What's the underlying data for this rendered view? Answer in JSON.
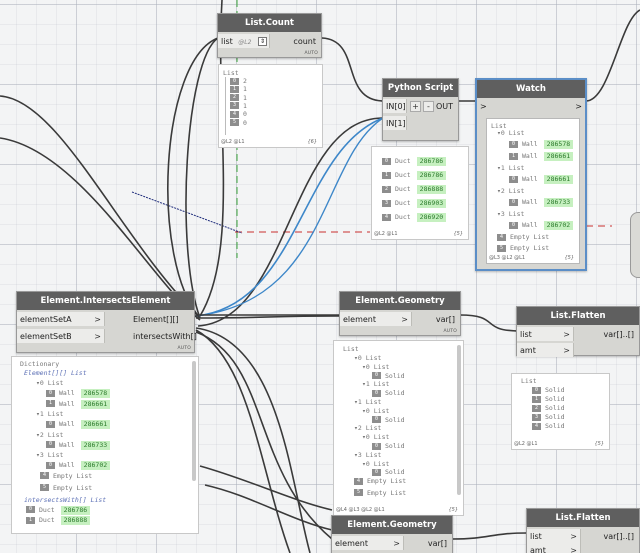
{
  "nodes": {
    "list_count": {
      "title": "List.Count",
      "input_label": "list",
      "input_hint": "@L2",
      "output_label": "count",
      "auto": "AUTO",
      "preview": {
        "header": "List",
        "items": [
          {
            "i": "0",
            "v": "2"
          },
          {
            "i": "1",
            "v": "1"
          },
          {
            "i": "2",
            "v": "1"
          },
          {
            "i": "3",
            "v": "1"
          },
          {
            "i": "4",
            "v": "0"
          },
          {
            "i": "5",
            "v": "0"
          }
        ],
        "levels": "@L2 @L1",
        "count": "{6}"
      }
    },
    "python_script": {
      "title": "Python Script",
      "inputs": [
        "IN[0]",
        "IN[1]"
      ],
      "plus": "+",
      "minus": "-",
      "output_label": "OUT",
      "preview": {
        "items": [
          {
            "i": "0",
            "type": "Duct",
            "id": "286786"
          },
          {
            "i": "1",
            "type": "Duct",
            "id": "286786"
          },
          {
            "i": "2",
            "type": "Duct",
            "id": "286888"
          },
          {
            "i": "3",
            "type": "Duct",
            "id": "286903"
          },
          {
            "i": "4",
            "type": "Duct",
            "id": "286920"
          }
        ],
        "levels": "@L2 @L1",
        "count": "{5}"
      }
    },
    "watch": {
      "title": "Watch",
      "input_arrow": ">",
      "output_arrow": ">",
      "preview": {
        "header": "List",
        "groups": [
          {
            "label": "0 List",
            "rows": [
              {
                "i": "0",
                "type": "Wall",
                "id": "286578"
              },
              {
                "i": "1",
                "type": "Wall",
                "id": "286661"
              }
            ]
          },
          {
            "label": "1 List",
            "rows": [
              {
                "i": "0",
                "type": "Wall",
                "id": "286661"
              }
            ]
          },
          {
            "label": "2 List",
            "rows": [
              {
                "i": "0",
                "type": "Wall",
                "id": "286733"
              }
            ]
          },
          {
            "label": "3 List",
            "rows": [
              {
                "i": "0",
                "type": "Wall",
                "id": "286702"
              }
            ]
          }
        ],
        "empties": [
          {
            "i": "4",
            "label": "Empty List"
          },
          {
            "i": "5",
            "label": "Empty List"
          }
        ],
        "levels": "@L3 @L2 @L1",
        "count": "{5}"
      }
    },
    "intersects": {
      "title": "Element.IntersectsElement",
      "inputs": [
        "elementSetA",
        "elementSetB"
      ],
      "outputs": [
        "Element[][]",
        "intersectsWith[]"
      ],
      "auto": "AUTO",
      "preview": {
        "header": "Dictionary",
        "key1": "Element[][] List",
        "groups": [
          {
            "label": "0 List",
            "rows": [
              {
                "i": "0",
                "type": "Wall",
                "id": "286578"
              },
              {
                "i": "1",
                "type": "Wall",
                "id": "286661"
              }
            ]
          },
          {
            "label": "1 List",
            "rows": [
              {
                "i": "0",
                "type": "Wall",
                "id": "286661"
              }
            ]
          },
          {
            "label": "2 List",
            "rows": [
              {
                "i": "0",
                "type": "Wall",
                "id": "286733"
              }
            ]
          },
          {
            "label": "3 List",
            "rows": [
              {
                "i": "0",
                "type": "Wall",
                "id": "286702"
              }
            ]
          }
        ],
        "empties": [
          {
            "i": "4",
            "label": "Empty List"
          },
          {
            "i": "5",
            "label": "Empty List"
          }
        ],
        "key2": "intersectsWith[] List",
        "rows2": [
          {
            "i": "0",
            "type": "Duct",
            "id": "286786"
          },
          {
            "i": "1",
            "type": "Duct",
            "id": "286888"
          }
        ]
      }
    },
    "geometry1": {
      "title": "Element.Geometry",
      "input_label": "element",
      "output_label": "var[]",
      "auto": "AUTO",
      "preview": {
        "header": "List",
        "groups": [
          {
            "label": "0 List",
            "sub": [
              {
                "label": "0 List",
                "rows": [
                  {
                    "i": "0",
                    "v": "Solid"
                  }
                ]
              },
              {
                "label": "1 List",
                "rows": [
                  {
                    "i": "0",
                    "v": "Solid"
                  }
                ]
              }
            ]
          },
          {
            "label": "1 List",
            "sub": [
              {
                "label": "0 List",
                "rows": [
                  {
                    "i": "0",
                    "v": "Solid"
                  }
                ]
              }
            ]
          },
          {
            "label": "2 List",
            "sub": [
              {
                "label": "0 List",
                "rows": [
                  {
                    "i": "0",
                    "v": "Solid"
                  }
                ]
              }
            ]
          },
          {
            "label": "3 List",
            "sub": [
              {
                "label": "0 List",
                "rows": [
                  {
                    "i": "0",
                    "v": "Solid"
                  }
                ]
              }
            ]
          }
        ],
        "empties": [
          {
            "i": "4",
            "label": "Empty List"
          },
          {
            "i": "5",
            "label": "Empty List"
          }
        ],
        "levels": "@L4 @L3 @L2 @L1",
        "count": "{5}"
      }
    },
    "flatten1": {
      "title": "List.Flatten",
      "inputs": [
        "list",
        "amt"
      ],
      "output_label": "var[]..[]",
      "preview": {
        "header": "List",
        "items": [
          {
            "i": "0",
            "v": "Solid"
          },
          {
            "i": "1",
            "v": "Solid"
          },
          {
            "i": "2",
            "v": "Solid"
          },
          {
            "i": "3",
            "v": "Solid"
          },
          {
            "i": "4",
            "v": "Solid"
          }
        ],
        "levels": "@L2 @L1",
        "count": "{5}"
      }
    },
    "geometry2": {
      "title": "Element.Geometry",
      "input_label": "element",
      "output_label": "var[]"
    },
    "flatten2": {
      "title": "List.Flatten",
      "inputs": [
        "list",
        "amt"
      ],
      "output_label": "var[]..[]"
    }
  },
  "colors": {
    "wire": "#3a3a3a",
    "wire_selected": "#3d87c9",
    "title_bar": "#5f5f5f",
    "node_body": "#d6d6d2",
    "value_highlight": "#c6f0c0",
    "value_text": "#2b7a2b",
    "grid": "#aab0ba"
  }
}
